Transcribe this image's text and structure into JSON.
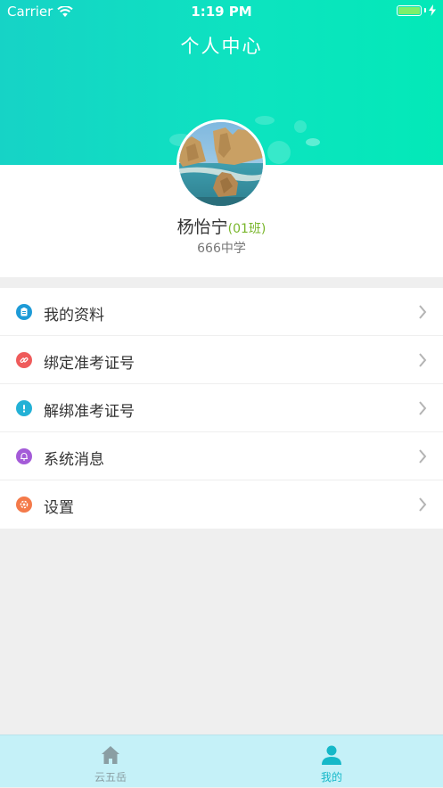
{
  "status_bar": {
    "carrier": "Carrier",
    "time": "1:19 PM"
  },
  "header": {
    "title": "个人中心"
  },
  "profile": {
    "name": "杨怡宁",
    "class": "(01班)",
    "school": "666中学"
  },
  "menu": {
    "items": [
      {
        "label": "我的资料",
        "icon": "profile-doc-icon",
        "color": "#1e9bd7"
      },
      {
        "label": "绑定准考证号",
        "icon": "link-icon",
        "color": "#ef5b5b"
      },
      {
        "label": "解绑准考证号",
        "icon": "exclamation-icon",
        "color": "#23b1d6"
      },
      {
        "label": "系统消息",
        "icon": "bell-icon",
        "color": "#a45bd8"
      },
      {
        "label": "设置",
        "icon": "settings-icon",
        "color": "#f47a4a"
      }
    ]
  },
  "tabbar": {
    "tabs": [
      {
        "label": "云五岳",
        "icon": "home-icon",
        "active": false
      },
      {
        "label": "我的",
        "icon": "person-icon",
        "active": true
      }
    ]
  },
  "colors": {
    "header_start": "#16d3c6",
    "header_end": "#03e9b8",
    "class_text": "#79b62b",
    "tab_active": "#15b8c8",
    "tab_inactive": "#8a9ea3"
  }
}
